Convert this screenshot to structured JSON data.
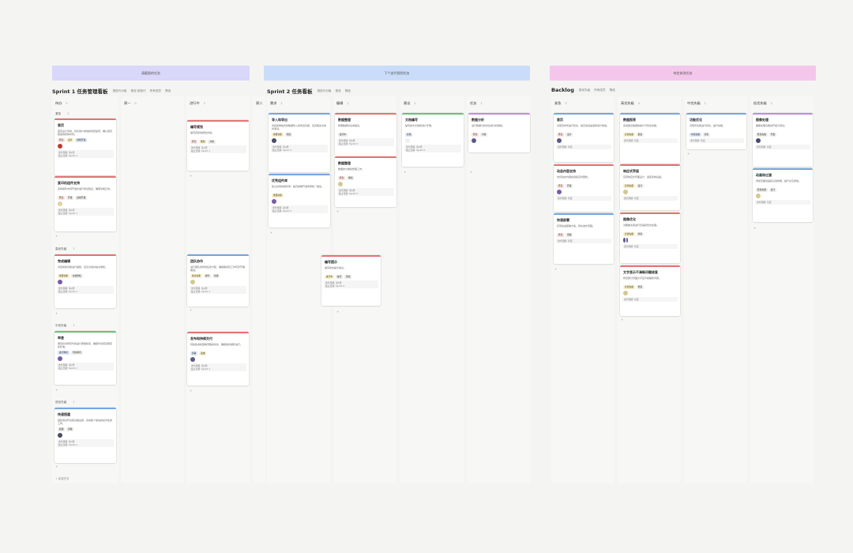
{
  "banners": [
    "请截图的任务",
    "下个迭代规划任务",
    "待定修改任务"
  ],
  "boards": [
    {
      "title": "Sprint 1 任务管理看板",
      "views": [
        "按迭代分组",
        "按态·按迭代",
        "所有成员",
        "筛选"
      ]
    },
    {
      "title": "Sprint 2 任务看板",
      "views": [
        "按迭代分组",
        "按态",
        "筛选"
      ]
    },
    {
      "title": "Backlog",
      "views": [
        "按优先级",
        "所有成员",
        "筛选"
      ]
    }
  ],
  "columns": {
    "b1c1": {
      "label": "待办",
      "count": "5"
    },
    "b1c2": {
      "label": "周一",
      "count": "0"
    },
    "b1c3": {
      "label": "进行中",
      "count": "3"
    },
    "b1c4": {
      "label": "周二",
      "count": ""
    },
    "b2c1": {
      "label": "需求",
      "count": "2"
    },
    "b2c2": {
      "label": "编辑",
      "count": "2"
    },
    "b2c3": {
      "label": "建议",
      "count": "1"
    },
    "b2c4": {
      "label": "任务",
      "count": "1"
    },
    "b3c1": {
      "label": "紧急",
      "count": "3"
    },
    "b3c2": {
      "label": "高优先级",
      "count": "4"
    },
    "b3c3": {
      "label": "中优先级",
      "count": "1"
    },
    "b3c4": {
      "label": "低优先级",
      "count": "2"
    }
  },
  "groups": {
    "g1": {
      "label": "紧急",
      "count": "2"
    },
    "g2": {
      "label": "高优先级",
      "count": "1"
    },
    "g3": {
      "label": "中优先级",
      "count": "1"
    },
    "g4": {
      "label": "低优先级",
      "count": "1"
    }
  },
  "new_label": "+ 新建任务",
  "meta_labels": {
    "sprint": "迭代周期",
    "date": "截止日期"
  },
  "cards": {
    "c1": {
      "title": "首页",
      "desc": "首页设计完成，优化用户体验和视觉呈现，确认首页框架的整体布局。",
      "tags": [
        "紧急",
        "设计",
        "前端开发"
      ],
      "m1": "迭代周期: 第1周",
      "m2": "截止日期: Sprint 1"
    },
    "c2": {
      "title": "复印机组件支持",
      "desc": "完成组件支持开发并进行测试验证，确保功能正常。",
      "tags": [
        "紧急",
        "开发",
        "后端开发"
      ],
      "m1": "迭代周期: 第1周",
      "m2": "截止日期: Sprint 1"
    },
    "c3": {
      "title": "完成编辑",
      "desc": "对完成的功能进行编辑，完善文档并提交审核。",
      "tags": [
        "重要功能",
        "文档审核"
      ],
      "m1": "迭代周期: 第2周",
      "m2": "截止日期: Sprint 1"
    },
    "c4": {
      "title": "审查",
      "desc": "审查并对所有代码进行质量检查，确保符合项目规范和标准。",
      "tags": [
        "进行审核",
        "代码审查"
      ],
      "m1": "迭代周期: 第2周",
      "m2": "截止日期: Sprint 1"
    },
    "c5": {
      "title": "快速搭建",
      "desc": "搭建测试环境和基础设施，完成各个模块的初步集成工作。",
      "tags": [
        "基础",
        "部署"
      ],
      "m1": "迭代周期: 第3周",
      "m2": "截止日期: Sprint 1"
    },
    "c6": {
      "title": "编写规划",
      "desc": "编写完整的规划文档。",
      "tags": [
        "紧急",
        "规划",
        "文档"
      ],
      "m1": "迭代周期: 第2周",
      "m2": "截止日期: Sprint 1"
    },
    "c7": {
      "title": "团队协作",
      "desc": "进行团队协作和任务分配，确保各成员工作有序开展推进。",
      "tags": [
        "重点功能",
        "协作",
        "沟通"
      ],
      "m1": "迭代周期: 第2周",
      "m2": "截止日期: Sprint 1"
    },
    "c8": {
      "title": "发布和持续交付",
      "desc": "持续集成和部署流程的优化，确保发布顺利进行。",
      "tags": [
        "部署",
        "运维"
      ],
      "m1": "迭代周期: 第3周",
      "m2": "截止日期: Sprint 1"
    },
    "c9": {
      "title": "导入和导出",
      "desc": "支持多种格式的数据导入和导出功能，完善相关文档并测试。",
      "tags": [
        "重要功能",
        "测试"
      ],
      "m1": "迭代周期: 第4周",
      "m2": "截止日期: Sprint 2"
    },
    "c10": {
      "title": "优秀组件库",
      "desc": "建立优秀的组件库，提高前端开发效率和一致性。",
      "tags": [
        "重要功能"
      ],
      "m1": "迭代周期: 第4周",
      "m2": "截止日期: Sprint 2"
    },
    "c11": {
      "title": "数据整理",
      "desc": "整理数据并生成报表。",
      "tags": [
        "进行中"
      ],
      "m1": "迭代周期: 第5周",
      "m2": "截止日期: Sprint 2"
    },
    "c12": {
      "title": "数据整理",
      "desc": "数据的分类和整理工作。",
      "tags": [
        "紧急",
        "规划"
      ],
      "m1": "迭代周期: 第5周",
      "m2": "截止日期: Sprint 2"
    },
    "c13": {
      "title": "文档编写",
      "desc": "编写技术文档和用户手册。",
      "tags": [
        "文档"
      ],
      "m1": "迭代周期: 第5周",
      "m2": "截止日期: Sprint 2"
    },
    "c14": {
      "title": "数据分析",
      "desc": "进行数据分析并生成分析报告。",
      "tags": [
        "紧急",
        "分析"
      ],
      "m1": "",
      "m2": ""
    },
    "c15": {
      "title": "编写提示",
      "desc": "编写新的提示信息。",
      "tags": [
        "进行中",
        "编写",
        "测试"
      ],
      "m1": "迭代周期: 第5周",
      "m2": "截止日期: Sprint 2"
    },
    "c16": {
      "title": "首页",
      "desc": "对首页布局进行优化，提高加载速度和用户体验。",
      "tags": [
        "紧急",
        "设计"
      ],
      "m1": "迭代周期: 待定",
      "m2": ""
    },
    "c17": {
      "title": "动态内容支持",
      "desc": "支持动态内容加载和实时更新。",
      "tags": [
        "紧急",
        "开发"
      ],
      "m1": "迭代周期: 待定",
      "m2": ""
    },
    "c18": {
      "title": "快速部署",
      "desc": "实现快速部署方案，简化发布流程。",
      "tags": [
        "紧急",
        "部署"
      ],
      "m1": "迭代周期: 待定",
      "m2": ""
    },
    "c19": {
      "title": "数据报表",
      "desc": "完成报表数据的统计与导出功能。",
      "tags": [
        "高优先级",
        "报表"
      ],
      "m1": "迭代周期: 待定",
      "m2": ""
    },
    "c20": {
      "title": "响应式界面",
      "desc": "实现响应式界面设计，适配多种设备。",
      "tags": [
        "高优先级",
        "设计"
      ],
      "m1": "迭代周期: 待定",
      "m2": ""
    },
    "c21": {
      "title": "图像优化",
      "desc": "对图像资源进行压缩和优化处理。",
      "tags": [
        "高优先级",
        "优化"
      ],
      "m1": "迭代周期: 待定",
      "m2": ""
    },
    "c22": {
      "title": "文字显示不清晰问题修复",
      "desc": "修复部分页面文字显示模糊的问题。",
      "tags": [
        "高优先级",
        "修复"
      ],
      "m1": "迭代周期: 待定",
      "m2": ""
    },
    "c23": {
      "title": "功能优化",
      "desc": "对现有功能进行优化，提升性能。",
      "tags": [
        "中优先级",
        "优化"
      ],
      "m1": "迭代周期: 待定",
      "m2": ""
    },
    "c24": {
      "title": "图像处理",
      "desc": "图像处理功能的开发与测试。",
      "tags": [
        "低优先级",
        "开发"
      ],
      "m1": "迭代周期: 待定",
      "m2": ""
    },
    "c25": {
      "title": "动画和过渡",
      "desc": "添加页面动画和过渡效果，提升交互体验。",
      "tags": [
        "低优先级",
        "设计"
      ],
      "m1": "迭代周期: 待定",
      "m2": ""
    }
  },
  "colors": {
    "banner1": "#d9d7fa",
    "banner2": "#c9dcfa",
    "banner3": "#f5c6ec",
    "red": "#e57373",
    "blue": "#74a7e3",
    "green": "#6bbf7a",
    "purple": "#c08be0",
    "tag_red": "#fbe3e1",
    "tag_yellow": "#fbf1c8",
    "tag_blue": "#dce8fa",
    "tag_gray": "#eeeeec"
  }
}
